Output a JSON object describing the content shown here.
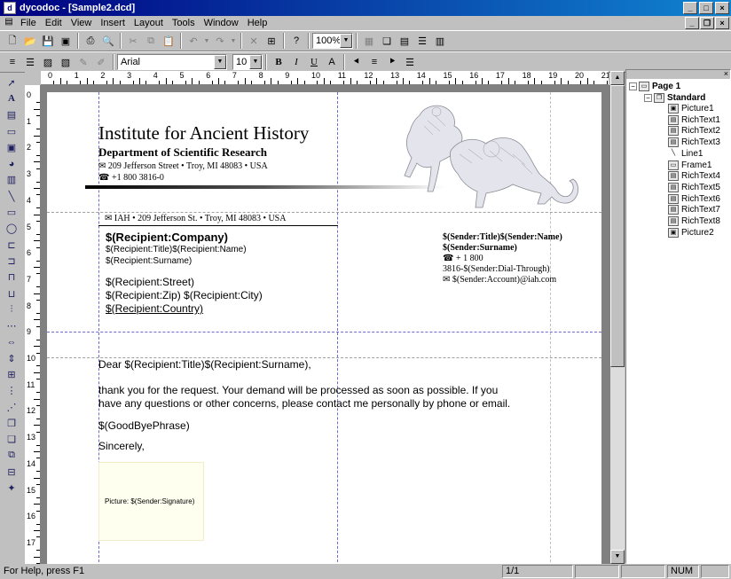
{
  "window": {
    "title": "dycodoc - [Sample2.dcd]",
    "min_btn": "_",
    "max_btn": "□",
    "close_btn": "×"
  },
  "menu": [
    "File",
    "Edit",
    "View",
    "Insert",
    "Layout",
    "Tools",
    "Window",
    "Help"
  ],
  "toolbar": {
    "zoom": "100%",
    "font": "Arial",
    "size": "10",
    "bold": "B",
    "italic": "I",
    "underline": "U"
  },
  "ruler": {
    "h_ticks": [
      "0",
      "1",
      "2",
      "3",
      "4",
      "5",
      "6",
      "7",
      "8",
      "9",
      "10",
      "11",
      "12",
      "13",
      "14",
      "15",
      "16",
      "17",
      "18",
      "19",
      "20",
      "21"
    ],
    "v_ticks": [
      "0",
      "1",
      "2",
      "3",
      "4",
      "5",
      "6",
      "7",
      "8",
      "9",
      "10",
      "11",
      "12",
      "13",
      "14",
      "15",
      "16",
      "17"
    ]
  },
  "document": {
    "inst_name": "Institute for Ancient History",
    "department": "Department of Scientific Research",
    "address": "✉ 209 Jefferson Street • Troy, MI 48083 • USA",
    "phone": "☎ +1 800 3816-0",
    "return_address": "✉ IAH • 209 Jefferson St. • Troy, MI 48083 • USA",
    "recipient_company": "$(Recipient:Company)",
    "recipient_title_name": "$(Recipient:Title)$(Recipient:Name)",
    "recipient_surname": "$(Recipient:Surname)",
    "recipient_street": "$(Recipient:Street)",
    "recipient_zip_city": "$(Recipient:Zip) $(Recipient:City)",
    "recipient_country": "$(Recipient:Country)",
    "sender_title_name": "$(Sender:Title)$(Sender:Name)",
    "sender_surname": "$(Sender:Surname)",
    "sender_phone": "☎ + 1 800",
    "sender_dial": "3816-$(Sender:Dial-Through)",
    "sender_email": "✉ $(Sender:Account)@iah.com",
    "salutation": "Dear $(Recipient:Title)$(Recipient:Surname),",
    "body_line1": "thank you for the request. Your demand will be processed as soon as possible. If you",
    "body_line2": "have any questions or other concerns, please contact me personally by phone or email.",
    "goodbye": "$(GoodByePhrase)",
    "closing": "Sincerely,",
    "signature": "Picture: $(Sender:Signature)"
  },
  "tree": {
    "page": "Page 1",
    "group": "Standard",
    "items": [
      "Picture1",
      "RichText1",
      "RichText2",
      "RichText3",
      "Line1",
      "Frame1",
      "RichText4",
      "RichText5",
      "RichText6",
      "RichText7",
      "RichText8",
      "Picture2"
    ]
  },
  "status": {
    "help": "For Help, press F1",
    "page": "1/1",
    "num": "NUM"
  },
  "colors": {
    "title_active": "#000080",
    "guide": "#6b6bd0"
  }
}
